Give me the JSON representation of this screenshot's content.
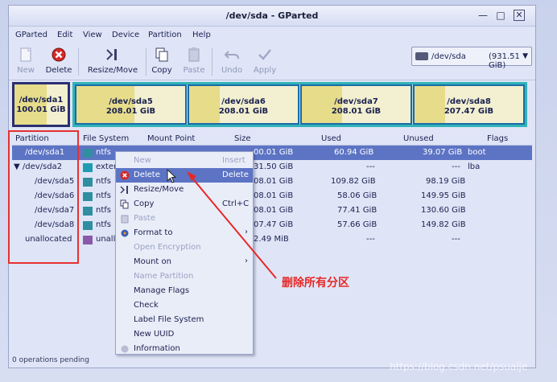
{
  "window": {
    "title": "/dev/sda - GParted"
  },
  "menu": [
    "GParted",
    "Edit",
    "View",
    "Device",
    "Partition",
    "Help"
  ],
  "toolbar": {
    "new": "New",
    "delete": "Delete",
    "resize": "Resize/Move",
    "copy": "Copy",
    "paste": "Paste",
    "undo": "Undo",
    "apply": "Apply"
  },
  "device": {
    "name": "/dev/sda",
    "size": "(931.51 GiB)"
  },
  "diskmap": [
    {
      "name": "/dev/sda1",
      "size": "100.01 GiB"
    },
    {
      "name": "/dev/sda5",
      "size": "208.01 GiB"
    },
    {
      "name": "/dev/sda6",
      "size": "208.01 GiB"
    },
    {
      "name": "/dev/sda7",
      "size": "208.01 GiB"
    },
    {
      "name": "/dev/sda8",
      "size": "207.47 GiB"
    }
  ],
  "columns": {
    "partition": "Partition",
    "filesystem": "File System",
    "mount": "Mount Point",
    "size": "Size",
    "used": "Used",
    "unused": "Unused",
    "flags": "Flags"
  },
  "rows": [
    {
      "partition": "/dev/sda1",
      "fs": "ntfs",
      "size": "00.01 GiB",
      "used": "60.94 GiB",
      "unused": "39.07 GiB",
      "flags": "boot"
    },
    {
      "partition": "▼ /dev/sda2",
      "fs": "exter",
      "size": "31.50 GiB",
      "used": "---",
      "unused": "---",
      "flags": "lba"
    },
    {
      "partition": "/dev/sda5",
      "fs": "ntfs",
      "size": "08.01 GiB",
      "used": "109.82 GiB",
      "unused": "98.19 GiB",
      "flags": ""
    },
    {
      "partition": "/dev/sda6",
      "fs": "ntfs",
      "size": "08.01 GiB",
      "used": "58.06 GiB",
      "unused": "149.95 GiB",
      "flags": ""
    },
    {
      "partition": "/dev/sda7",
      "fs": "ntfs",
      "size": "08.01 GiB",
      "used": "77.41 GiB",
      "unused": "130.60 GiB",
      "flags": ""
    },
    {
      "partition": "/dev/sda8",
      "fs": "ntfs",
      "size": "07.47 GiB",
      "used": "57.66 GiB",
      "unused": "149.82 GiB",
      "flags": ""
    },
    {
      "partition": "unallocated",
      "fs": "unallo",
      "size": "2.49 MiB",
      "used": "---",
      "unused": "---",
      "flags": ""
    }
  ],
  "context_menu": [
    {
      "label": "New",
      "accel": "Insert"
    },
    {
      "label": "Delete",
      "accel": "Delete"
    },
    {
      "label": "Resize/Move",
      "accel": ""
    },
    {
      "label": "Copy",
      "accel": "Ctrl+C"
    },
    {
      "label": "Paste",
      "accel": ""
    },
    {
      "label": "Format to",
      "accel": ""
    },
    {
      "label": "Open Encryption",
      "accel": ""
    },
    {
      "label": "Mount on",
      "accel": ""
    },
    {
      "label": "Name Partition",
      "accel": ""
    },
    {
      "label": "Manage Flags",
      "accel": ""
    },
    {
      "label": "Check",
      "accel": ""
    },
    {
      "label": "Label File System",
      "accel": ""
    },
    {
      "label": "New UUID",
      "accel": ""
    },
    {
      "label": "Information",
      "accel": ""
    }
  ],
  "status": "0 operations pending",
  "annotation": "删除所有分区",
  "watermark": "https://blog.csdn.net/psuaije",
  "colors": {
    "selection": "#5d74c4",
    "annotation": "#e82828",
    "used": "#e6dc8a",
    "extended": "#31b4b8"
  }
}
